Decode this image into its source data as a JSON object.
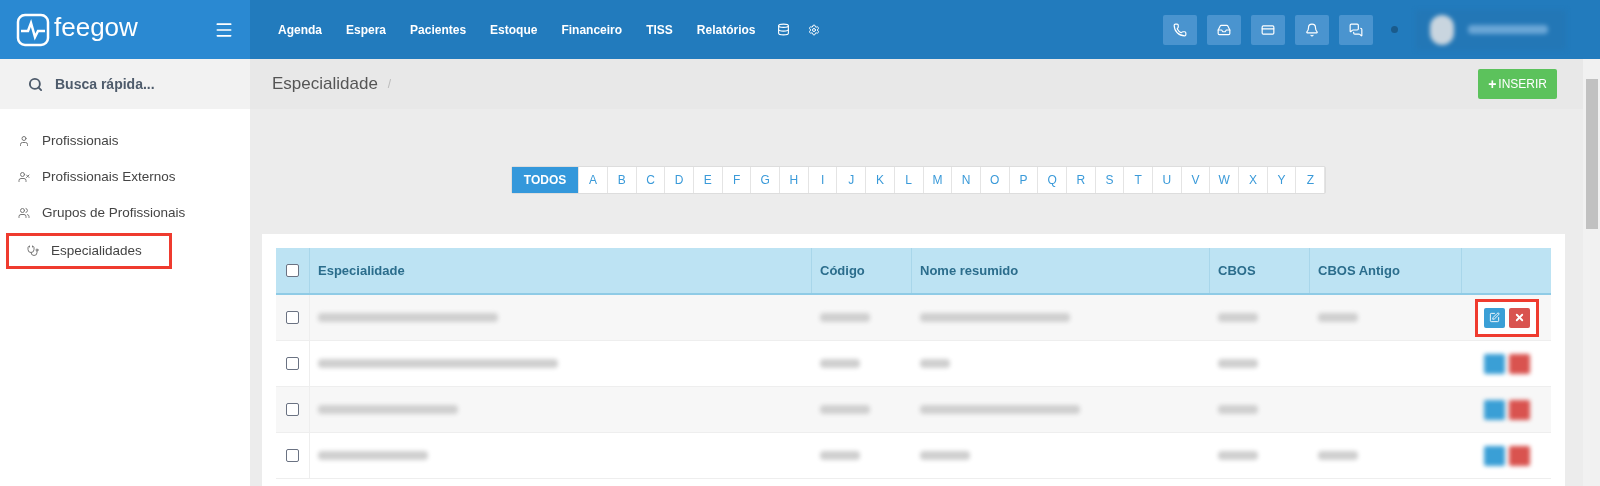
{
  "brand": {
    "name": "feegow"
  },
  "nav": {
    "items": [
      "Agenda",
      "Espera",
      "Pacientes",
      "Estoque",
      "Financeiro",
      "TISS",
      "Relatórios"
    ]
  },
  "search": {
    "placeholder": "Busca rápida..."
  },
  "breadcrumb": {
    "title": "Especialidade",
    "separator": "/"
  },
  "insert_button": {
    "icon": "+",
    "label": "INSERIR"
  },
  "sidebar": {
    "items": [
      {
        "label": "Profissionais",
        "highlighted": false
      },
      {
        "label": "Profissionais Externos",
        "highlighted": false
      },
      {
        "label": "Grupos de Profissionais",
        "highlighted": false
      },
      {
        "label": "Especialidades",
        "highlighted": true
      }
    ]
  },
  "letters": [
    {
      "label": "TODOS",
      "selected": true
    },
    {
      "label": "A",
      "selected": false
    },
    {
      "label": "B",
      "selected": false
    },
    {
      "label": "C",
      "selected": false
    },
    {
      "label": "D",
      "selected": false
    },
    {
      "label": "E",
      "selected": false
    },
    {
      "label": "F",
      "selected": false
    },
    {
      "label": "G",
      "selected": false
    },
    {
      "label": "H",
      "selected": false
    },
    {
      "label": "I",
      "selected": false
    },
    {
      "label": "J",
      "selected": false
    },
    {
      "label": "K",
      "selected": false
    },
    {
      "label": "L",
      "selected": false
    },
    {
      "label": "M",
      "selected": false
    },
    {
      "label": "N",
      "selected": false
    },
    {
      "label": "O",
      "selected": false
    },
    {
      "label": "P",
      "selected": false
    },
    {
      "label": "Q",
      "selected": false
    },
    {
      "label": "R",
      "selected": false
    },
    {
      "label": "S",
      "selected": false
    },
    {
      "label": "T",
      "selected": false
    },
    {
      "label": "U",
      "selected": false
    },
    {
      "label": "V",
      "selected": false
    },
    {
      "label": "W",
      "selected": false
    },
    {
      "label": "X",
      "selected": false
    },
    {
      "label": "Y",
      "selected": false
    },
    {
      "label": "Z",
      "selected": false
    }
  ],
  "table": {
    "header_checked": false,
    "columns": [
      "Especialidade",
      "Código",
      "Nome resumido",
      "CBOS",
      "CBOS Antigo"
    ],
    "rows": [
      {
        "checked": false,
        "highlighted": true,
        "actions_blurred": false,
        "cells": [
          {
            "filled": true
          },
          {
            "filled": true
          },
          {
            "filled": true
          },
          {
            "filled": true
          },
          {
            "filled": true
          }
        ]
      },
      {
        "checked": false,
        "highlighted": false,
        "actions_blurred": true,
        "cells": [
          {
            "filled": true
          },
          {
            "filled": true
          },
          {
            "filled": true
          },
          {
            "filled": true
          },
          {
            "filled": false
          }
        ]
      },
      {
        "checked": false,
        "highlighted": false,
        "actions_blurred": true,
        "cells": [
          {
            "filled": true
          },
          {
            "filled": true
          },
          {
            "filled": true
          },
          {
            "filled": true
          },
          {
            "filled": false
          }
        ]
      },
      {
        "checked": false,
        "highlighted": false,
        "actions_blurred": true,
        "cells": [
          {
            "filled": true
          },
          {
            "filled": true
          },
          {
            "filled": true
          },
          {
            "filled": true
          },
          {
            "filled": true
          }
        ]
      }
    ]
  }
}
